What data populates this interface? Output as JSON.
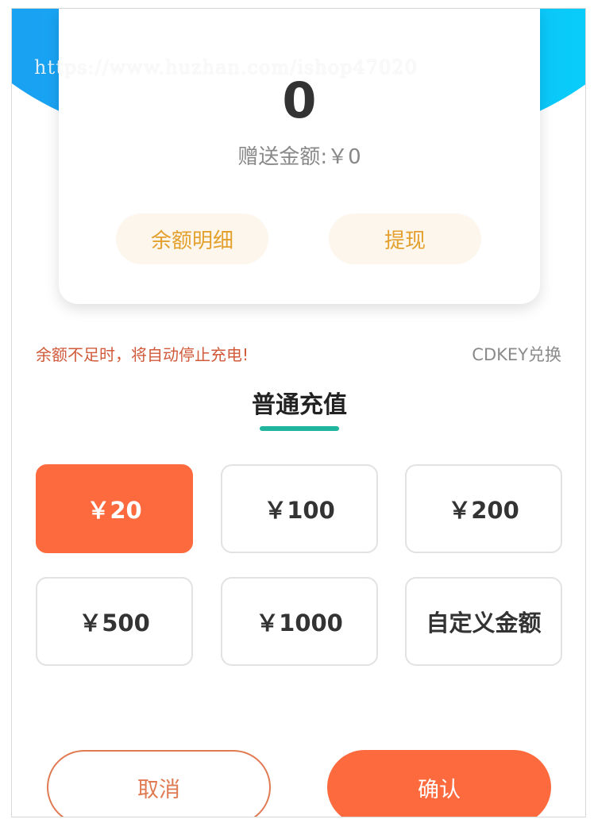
{
  "watermark": "https://www.huzhan.com/ishop47020",
  "wallet": {
    "balance": "0",
    "gift_label": "赠送金额:",
    "gift_value": "￥0",
    "detail_button": "余额明细",
    "withdraw_button": "提现"
  },
  "notice": {
    "warning": "余额不足时，将自动停止充电!",
    "cdkey_link": "CDKEY兑换"
  },
  "recharge": {
    "tab_label": "普通充值",
    "selected_index": 0,
    "options": [
      {
        "label": "￥20"
      },
      {
        "label": "￥100"
      },
      {
        "label": "￥200"
      },
      {
        "label": "￥500"
      },
      {
        "label": "￥1000"
      },
      {
        "label": "自定义金额"
      }
    ]
  },
  "actions": {
    "cancel": "取消",
    "confirm": "确认"
  },
  "colors": {
    "header_gradient_start": "#1a9df2",
    "header_gradient_end": "#05d3fb",
    "accent_orange": "#fd6a3e",
    "tab_underline": "#20b59c",
    "detail_button_text": "#e3a02d"
  }
}
